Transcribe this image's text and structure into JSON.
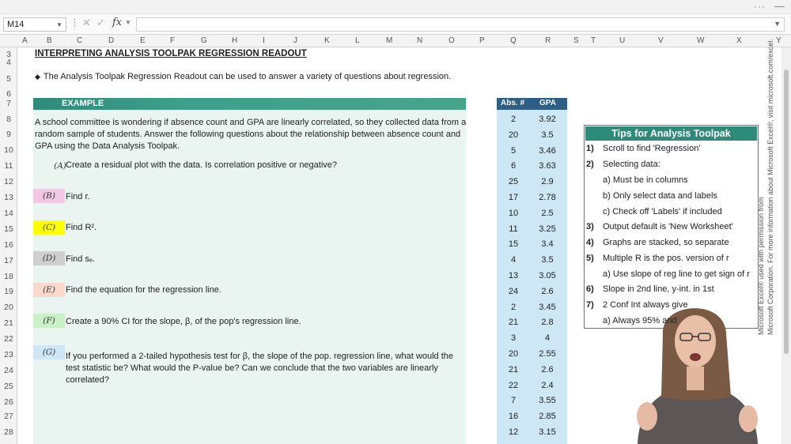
{
  "window": {
    "more_label": "···",
    "minimize_label": "—"
  },
  "formula_bar": {
    "cell_ref": "M14",
    "fx_label": "fx",
    "formula": ""
  },
  "columns": [
    "A",
    "B",
    "C",
    "D",
    "E",
    "F",
    "G",
    "H",
    "I",
    "J",
    "K",
    "L",
    "M",
    "N",
    "O",
    "P",
    "Q",
    "R",
    "S",
    "T",
    "U",
    "V",
    "W",
    "X",
    "Y"
  ],
  "rows": [
    "3",
    "4",
    "5",
    "6",
    "7",
    "8",
    "9",
    "10",
    "11",
    "12",
    "13",
    "14",
    "15",
    "16",
    "17",
    "18",
    "19",
    "20",
    "21",
    "22",
    "23",
    "24",
    "25",
    "26",
    "27",
    "28"
  ],
  "sheet": {
    "title": "INTERPRETING ANALYSIS TOOLPAK REGRESSION READOUT",
    "intro": "The Analysis Toolpak Regression Readout can be used to answer a variety of questions about regression.",
    "example_label": "EXAMPLE",
    "scenario_lines": [
      "A school committee is wondering if absence count and GPA are linearly correlated, so they collected data from a",
      "random sample of students.  Answer the following questions about the relationship between absence count and",
      "GPA using the Data Analysis Toolpak."
    ],
    "problems": [
      {
        "tag": "(A)",
        "text": "Create a residual plot with the data. Is correlation positive or negative?",
        "color": "#eaf4f1"
      },
      {
        "tag": "(B)",
        "text": "Find r.",
        "color": "#f4c6e6"
      },
      {
        "tag": "(C)",
        "text": "Find R².",
        "color": "#ffff00"
      },
      {
        "tag": "(D)",
        "text": "Find sₑ.",
        "color": "#cfcfcf"
      },
      {
        "tag": "(E)",
        "text": "Find the equation for the regression line.",
        "color": "#f9d9cc"
      },
      {
        "tag": "(F)",
        "text": "Create a 90% CI for the slope, β, of the pop's regression line.",
        "color": "#c9f0c6"
      },
      {
        "tag": "(G)",
        "text_lines": [
          "If you performed a 2-tailed hypothesis test for β, the slope of the pop. regression line, what would the",
          "test statistic be? What would the P-value be? Can we conclude that the two variables are linearly",
          "correlated?"
        ],
        "color": "#cfe6f6"
      }
    ]
  },
  "data_table": {
    "headers": [
      "Abs. #",
      "GPA"
    ],
    "rows": [
      [
        "2",
        "3.92"
      ],
      [
        "20",
        "3.5"
      ],
      [
        "5",
        "3.46"
      ],
      [
        "6",
        "3.63"
      ],
      [
        "25",
        "2.9"
      ],
      [
        "17",
        "2.78"
      ],
      [
        "10",
        "2.5"
      ],
      [
        "11",
        "3.25"
      ],
      [
        "15",
        "3.4"
      ],
      [
        "4",
        "3.5"
      ],
      [
        "13",
        "3.05"
      ],
      [
        "24",
        "2.6"
      ],
      [
        "2",
        "3.45"
      ],
      [
        "21",
        "2.8"
      ],
      [
        "3",
        "4"
      ],
      [
        "20",
        "2.55"
      ],
      [
        "21",
        "2.6"
      ],
      [
        "22",
        "2.4"
      ],
      [
        "7",
        "3.55"
      ],
      [
        "16",
        "2.85"
      ],
      [
        "12",
        "3.15"
      ]
    ]
  },
  "tips": {
    "title": "Tips for Analysis Toolpak",
    "lines": [
      {
        "num": "1)",
        "text": "Scroll to find 'Regression'"
      },
      {
        "num": "2)",
        "text": "Selecting data:"
      },
      {
        "num": "",
        "text": "a) Must be in columns"
      },
      {
        "num": "",
        "text": "b) Only select data and labels"
      },
      {
        "num": "",
        "text": "c) Check off 'Labels' if included"
      },
      {
        "num": "3)",
        "text": "Output default is 'New Worksheet'"
      },
      {
        "num": "4)",
        "text": "Graphs are stacked, so separate"
      },
      {
        "num": "5)",
        "text": "Multiple R is the pos. version of r"
      },
      {
        "num": "",
        "text": "a) Use slope of reg line to get sign of r"
      },
      {
        "num": "6)",
        "text": "Slope in 2nd line, y-int. in 1st"
      },
      {
        "num": "7)",
        "text": "2 Conf Int always give"
      },
      {
        "num": "",
        "text": "a) Always 95% and"
      }
    ]
  },
  "copyright": {
    "line1": "Microsoft Excel® used with permission from",
    "line2": "Microsoft Corporation. For more information about Microsoft Excel®, visit microsoft.com/excel."
  },
  "colors": {
    "accent_green": "#2e8b79",
    "panel_green": "#eaf4f1",
    "data_blue": "#cde7f5",
    "data_header": "#2c5e86"
  }
}
